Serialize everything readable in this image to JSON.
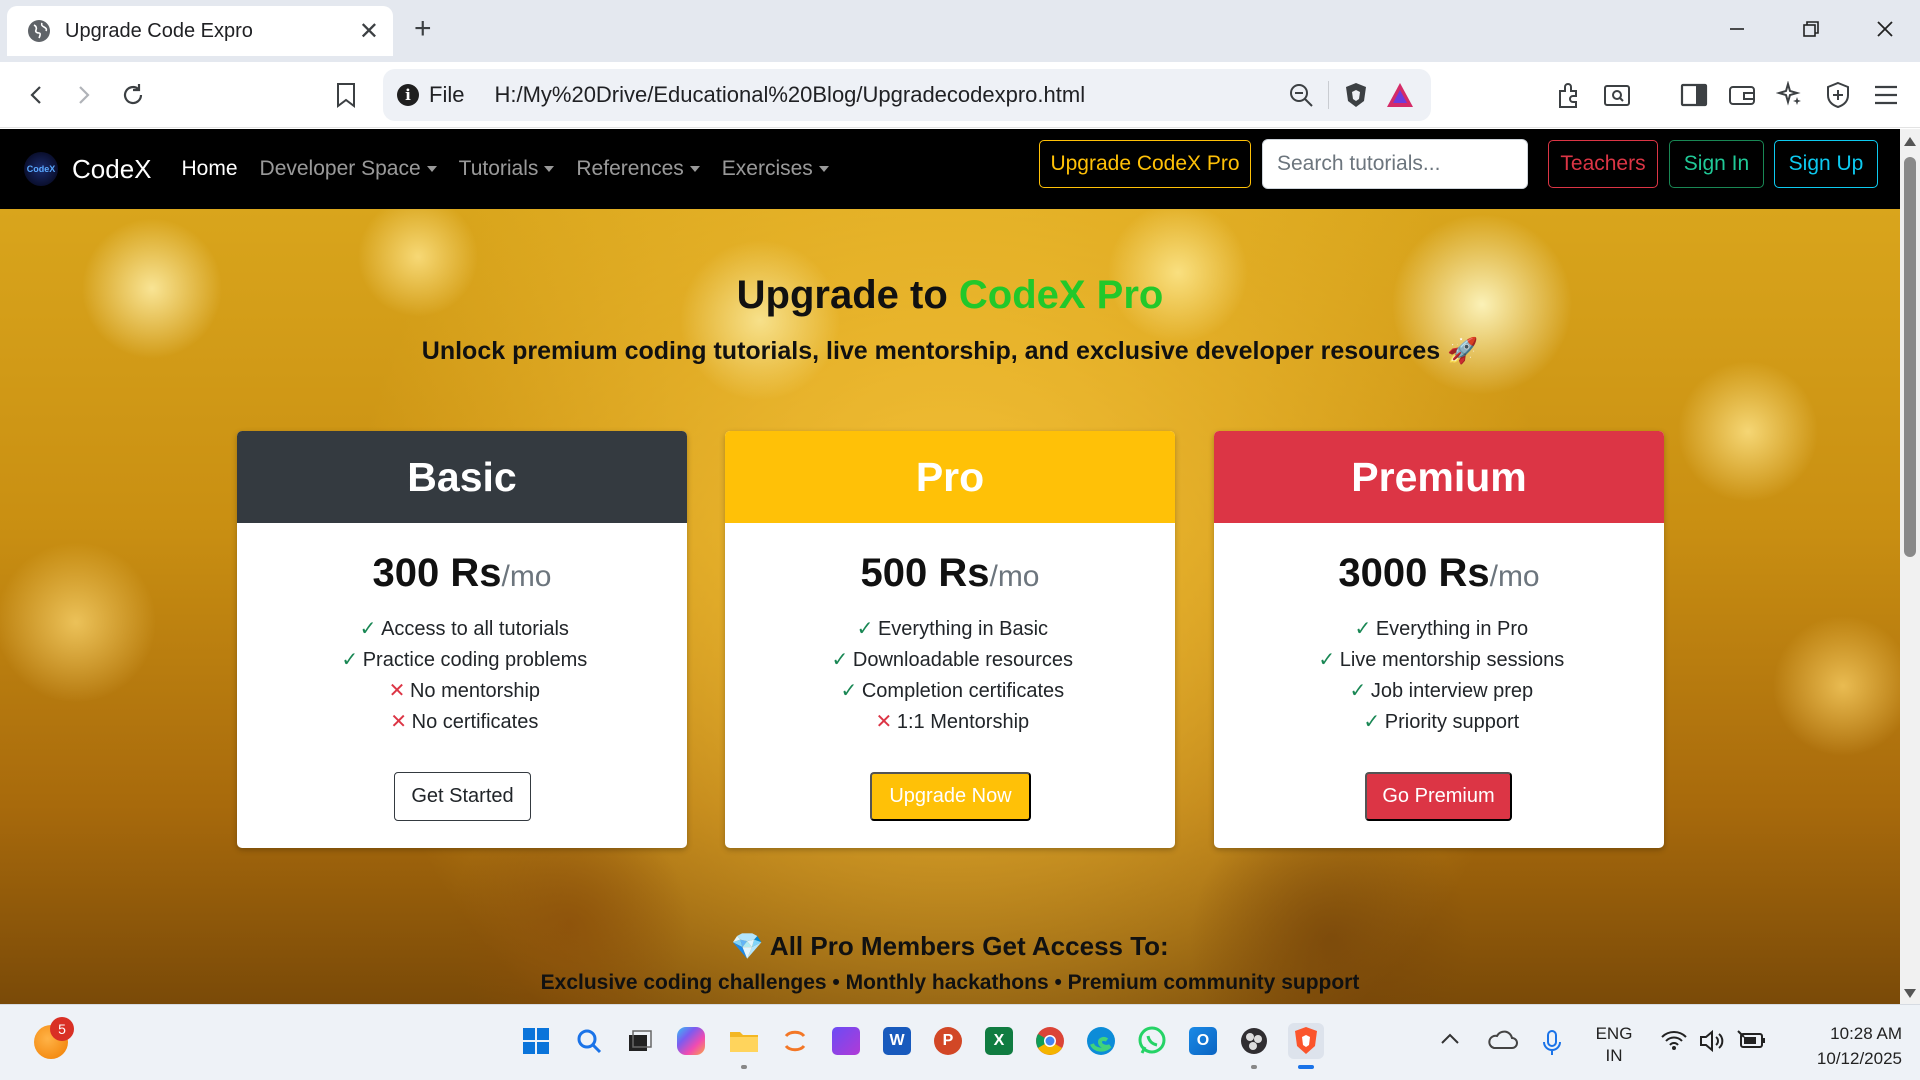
{
  "browser": {
    "tab_title": "Upgrade Code Expro",
    "tab_close": "✕",
    "new_tab": "+",
    "omnibox": {
      "scheme": "File",
      "url": "H:/My%20Drive/Educational%20Blog/Upgradecodexpro.html"
    }
  },
  "navbar": {
    "brand_logo_text": "CodeX",
    "brand": "CodeX",
    "links": [
      "Home",
      "Developer Space",
      "Tutorials",
      "References",
      "Exercises"
    ],
    "upgrade_button": "Upgrade CodeX Pro",
    "search_placeholder": "Search tutorials...",
    "teachers_button": "Teachers",
    "signin_button": "Sign In",
    "signup_button": "Sign Up"
  },
  "hero": {
    "title_prefix": "Upgrade to ",
    "title_accent": "CodeX Pro",
    "subtitle": "Unlock premium coding tutorials, live mentorship, and exclusive developer resources 🚀"
  },
  "plans": [
    {
      "name": "Basic",
      "price": "300 Rs",
      "period": "/mo",
      "features": [
        {
          "included": true,
          "text": "Access to all tutorials"
        },
        {
          "included": true,
          "text": "Practice coding problems"
        },
        {
          "included": false,
          "text": "No mentorship"
        },
        {
          "included": false,
          "text": "No certificates"
        }
      ],
      "cta": "Get Started"
    },
    {
      "name": "Pro",
      "price": "500 Rs",
      "period": "/mo",
      "features": [
        {
          "included": true,
          "text": "Everything in Basic"
        },
        {
          "included": true,
          "text": "Downloadable resources"
        },
        {
          "included": true,
          "text": "Completion certificates"
        },
        {
          "included": false,
          "text": "1:1 Mentorship"
        }
      ],
      "cta": "Upgrade Now"
    },
    {
      "name": "Premium",
      "price": "3000 Rs",
      "period": "/mo",
      "features": [
        {
          "included": true,
          "text": "Everything in Pro"
        },
        {
          "included": true,
          "text": "Live mentorship sessions"
        },
        {
          "included": true,
          "text": "Job interview prep"
        },
        {
          "included": true,
          "text": "Priority support"
        }
      ],
      "cta": "Go Premium"
    }
  ],
  "marks": {
    "yes": "✓",
    "no": "✕"
  },
  "access": {
    "title": "💎 All Pro Members Get Access To:",
    "list": "Exclusive coding challenges • Monthly hackathons • Premium community support"
  },
  "taskbar": {
    "notification_count": "5",
    "language": "ENG",
    "region": "IN",
    "time": "10:28 AM",
    "date": "10/12/2025"
  },
  "colors": {
    "accent_green": "#22c82a",
    "basic_header": "#343a40",
    "pro_header": "#ffc107",
    "premium_header": "#dc3545",
    "navbar_bg": "#000000"
  }
}
